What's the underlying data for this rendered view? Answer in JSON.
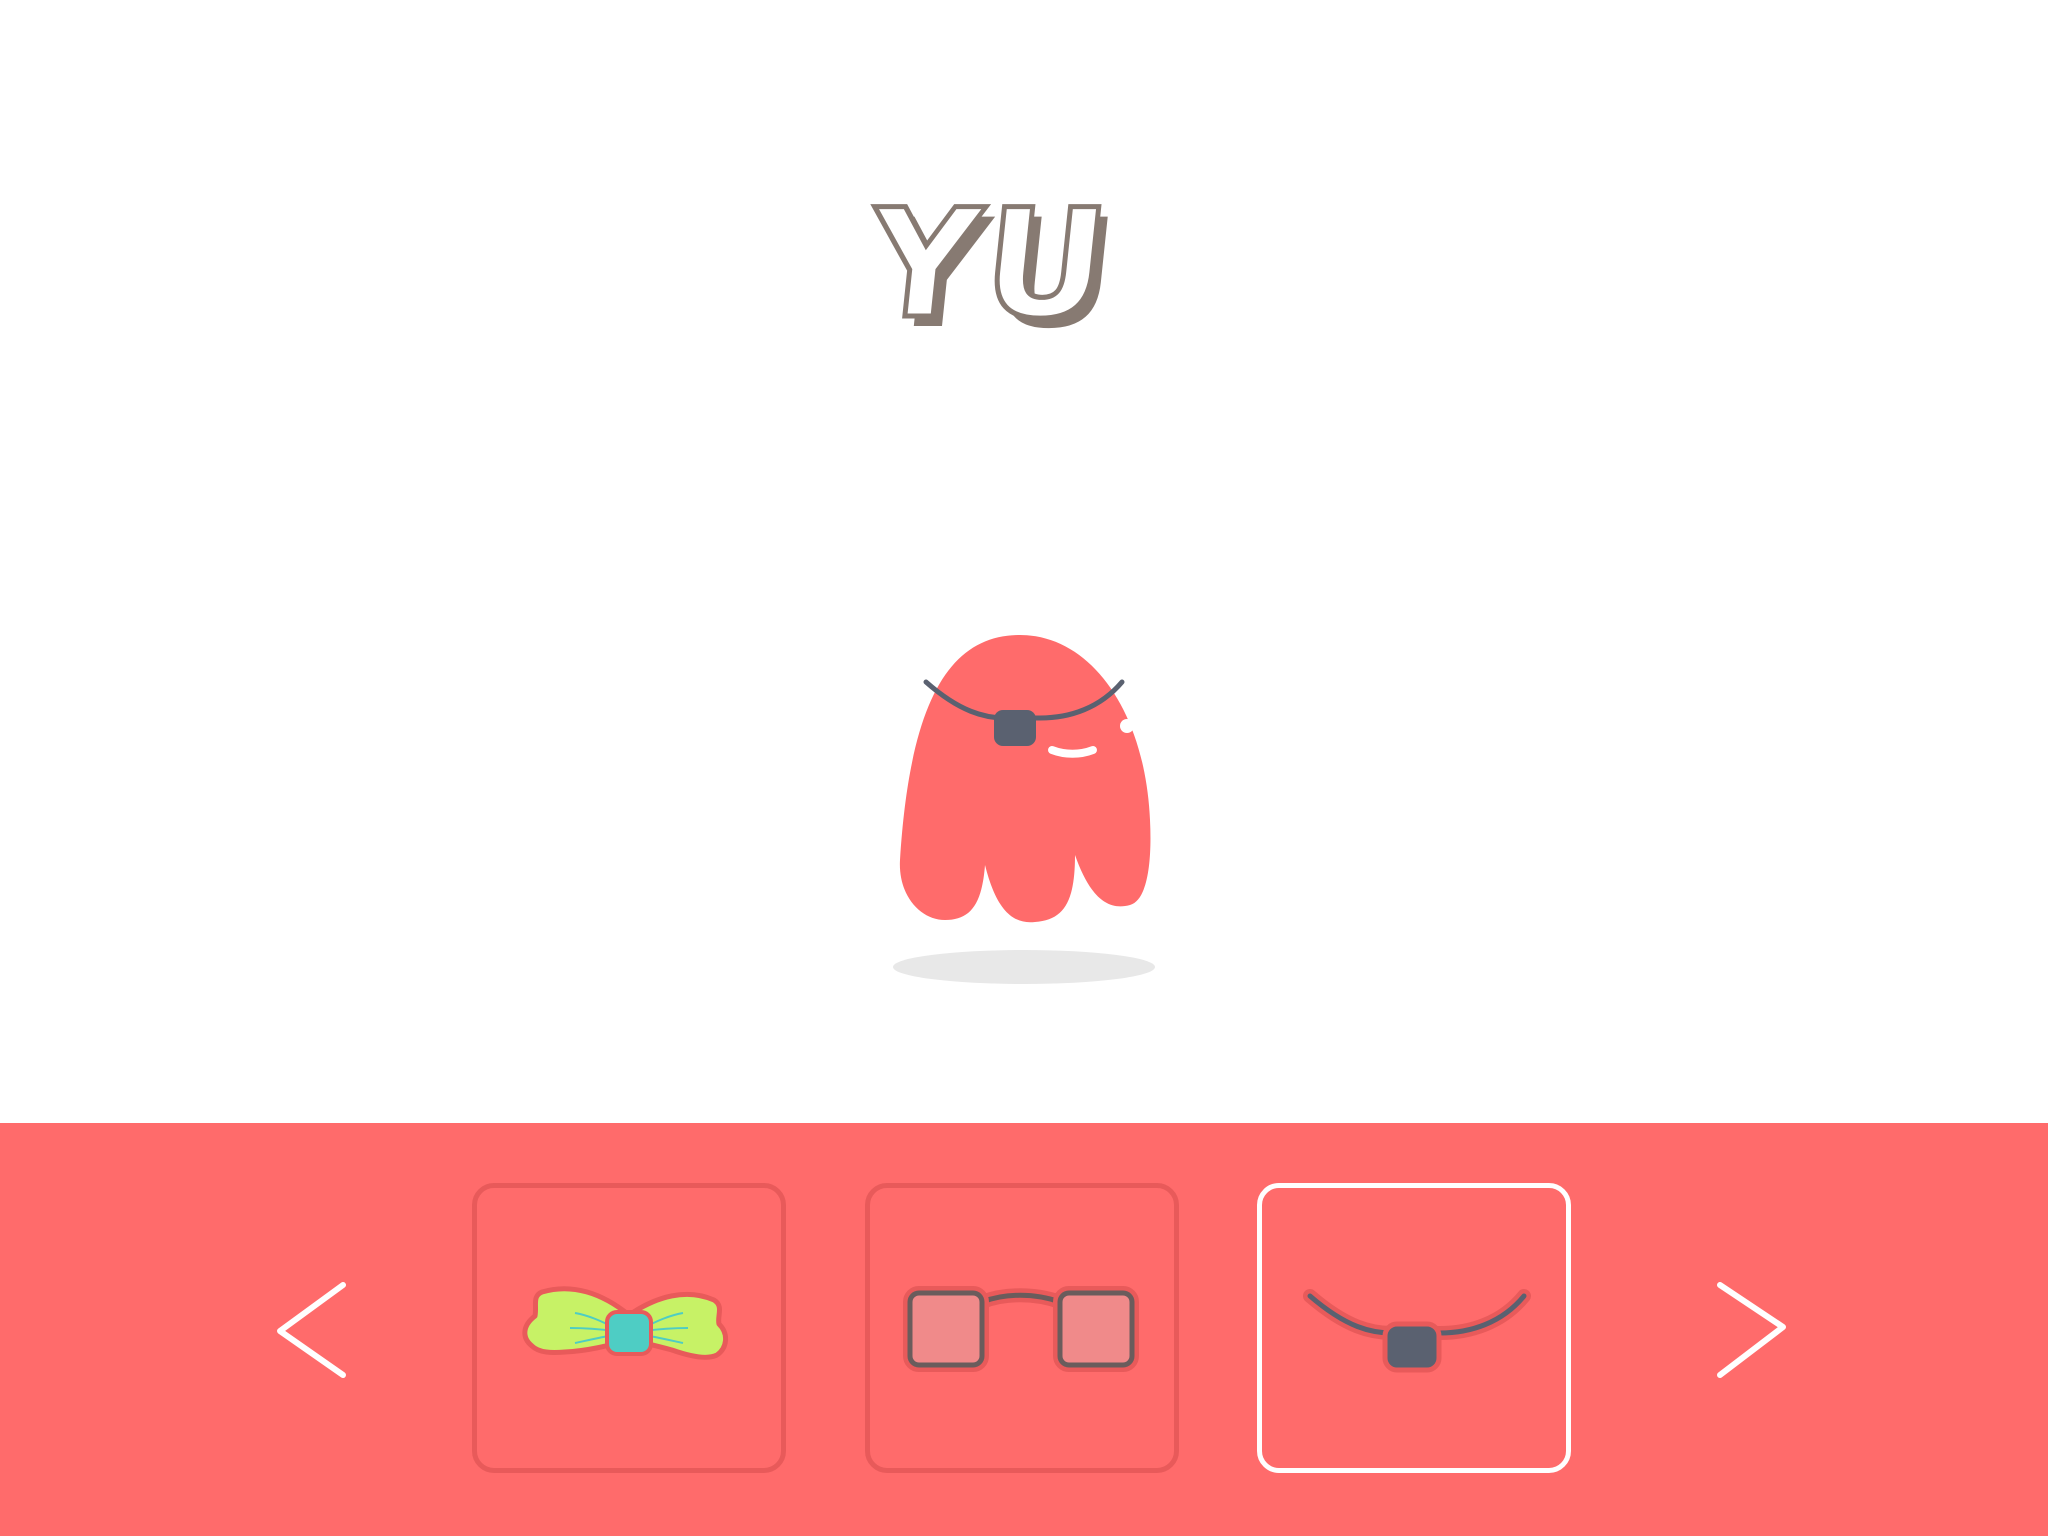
{
  "title": "YU",
  "colors": {
    "background": "#ffffff",
    "tray": "#ff6b6b",
    "character": "#ff6b6b",
    "title_fill": "#ffffff",
    "title_outline": "#877a72",
    "selected_border": "#ffffff",
    "unselected_border": "#e85a5a"
  },
  "character": {
    "accessory": "eyepatch-icon"
  },
  "navigation": {
    "prev_icon": "chevron-left-icon",
    "next_icon": "chevron-right-icon"
  },
  "accessories": [
    {
      "icon": "bow-tie-icon",
      "selected": false
    },
    {
      "icon": "glasses-icon",
      "selected": false
    },
    {
      "icon": "eyepatch-icon",
      "selected": true
    }
  ]
}
